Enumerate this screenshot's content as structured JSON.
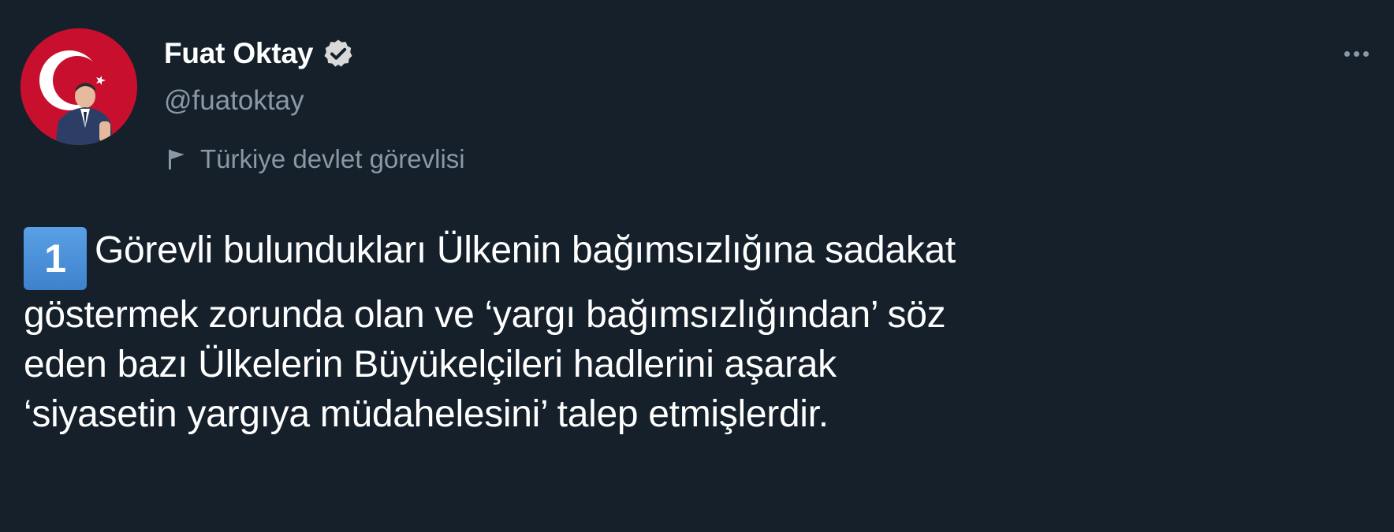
{
  "tweet": {
    "author": {
      "display_name": "Fuat Oktay",
      "handle": "@fuatoktay",
      "verified": true,
      "account_label": "Türkiye devlet görevlisi"
    },
    "icons": {
      "verified": "verified-badge-icon",
      "label": "flag-icon",
      "more": "more-options-icon"
    },
    "keycap_digit": "1",
    "text_lines": [
      "Görevli bulundukları Ülkenin bağımsızlığına sadakat",
      "göstermek zorunda olan ve ‘yargı bağımsızlığından’ söz",
      "eden bazı Ülkelerin Büyükelçileri hadlerini aşarak",
      "‘siyasetin yargıya müdahelesini’ talep etmişlerdir."
    ],
    "colors": {
      "background": "#15202b",
      "text": "#ffffff",
      "secondary_text": "#8b98a5",
      "keycap": "#4a90d9"
    }
  }
}
